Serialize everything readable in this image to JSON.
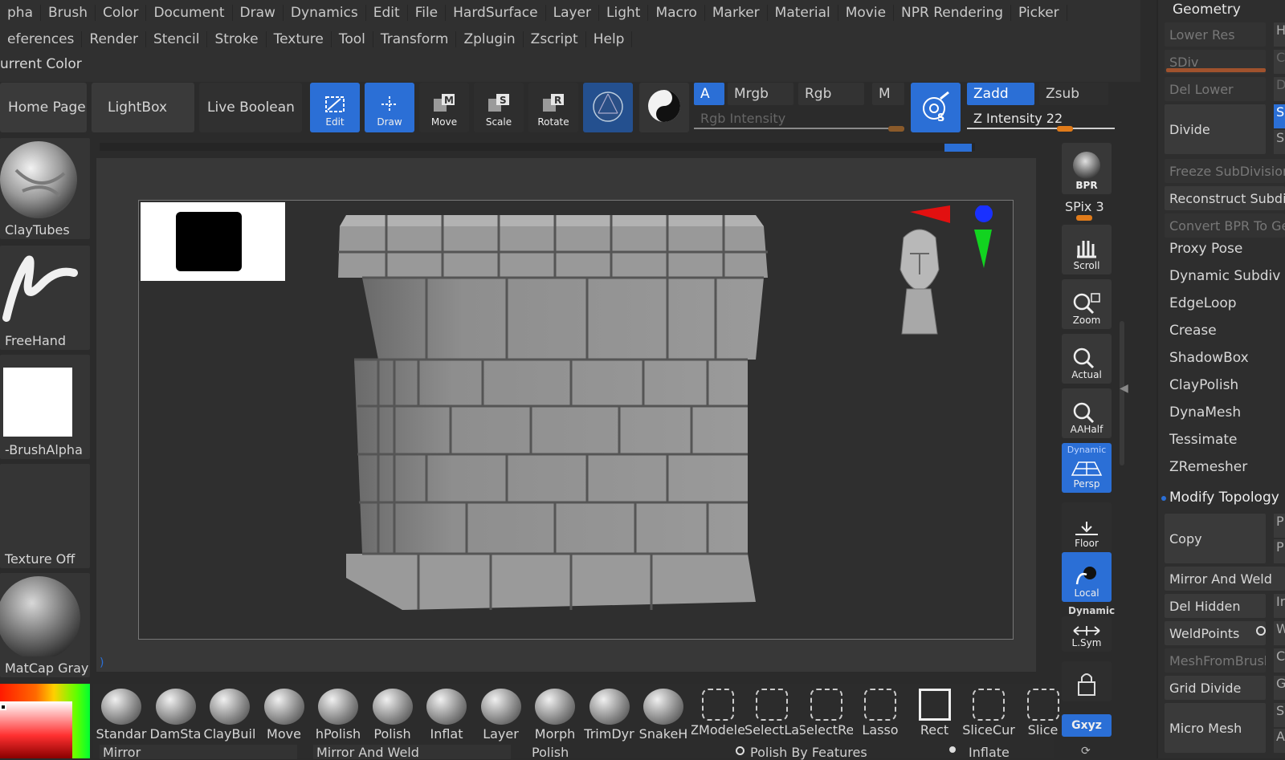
{
  "menu_row1": [
    "pha",
    "Brush",
    "Color",
    "Document",
    "Draw",
    "Dynamics",
    "Edit",
    "File",
    "HardSurface",
    "Layer",
    "Light",
    "Macro",
    "Marker",
    "Material",
    "Movie",
    "NPR Rendering",
    "Picker"
  ],
  "menu_row2": [
    "eferences",
    "Render",
    "Stencil",
    "Stroke",
    "Texture",
    "Tool",
    "Transform",
    "Zplugin",
    "Zscript",
    "Help"
  ],
  "current_color": "urrent Color",
  "shelf": {
    "home": "Home Page",
    "lightbox": "LightBox",
    "live_boolean": "Live Boolean",
    "tools": [
      "Edit",
      "Draw",
      "Move",
      "Scale",
      "Rotate"
    ]
  },
  "color_modes": {
    "a": "A",
    "mrgb": "Mrgb",
    "rgb": "Rgb",
    "m": "M",
    "rgb_intensity": "Rgb Intensity",
    "zadd": "Zadd",
    "zsub": "Zsub",
    "z_intensity": "Z Intensity 22"
  },
  "left": {
    "brush": "ClayTubes",
    "stroke": "FreeHand",
    "alpha": "-BrushAlpha",
    "texture": "Texture Off",
    "material": "MatCap Gray"
  },
  "right_shelf": {
    "bpr": "BPR",
    "spix": "SPix 3",
    "scroll": "Scroll",
    "zoom": "Zoom",
    "actual": "Actual",
    "aahalf": "AAHalf",
    "dynamic": "Dynamic",
    "persp": "Persp",
    "floor": "Floor",
    "local": "Local",
    "dynamic2": "Dynamic",
    "lsym": "L.Sym",
    "xyz": "Gxyz"
  },
  "geometry": {
    "title": "Geometry",
    "lower_res": "Lower Res",
    "sdiv": "SDiv",
    "del_lower": "Del Lower",
    "divide": "Divide",
    "freeze": "Freeze SubDivision",
    "reconstruct": "Reconstruct Subdiv",
    "convert_bpr": "Convert BPR To Geo",
    "items": [
      "Proxy Pose",
      "Dynamic Subdiv",
      "EdgeLoop",
      "Crease",
      "ShadowBox",
      "ClayPolish",
      "DynaMesh",
      "Tessimate",
      "ZRemesher"
    ],
    "modify_topology": "Modify Topology",
    "copy": "Copy",
    "mirror_weld": "Mirror And Weld",
    "del_hidden": "Del Hidden",
    "weldpoints": "WeldPoints",
    "meshfrombrush": "MeshFromBrush",
    "grid_divide": "Grid Divide",
    "micro_mesh": "Micro Mesh",
    "side": [
      "H",
      "C",
      "D",
      "S",
      "S",
      "P",
      "P",
      "Ir",
      "W",
      "C",
      "G",
      "S",
      "A"
    ]
  },
  "brushes": [
    "Standar",
    "DamSta",
    "ClayBuil",
    "Move",
    "hPolish",
    "Polish",
    "Inflat",
    "Layer",
    "Morph",
    "TrimDyr",
    "SnakeH",
    "ZModele",
    "SelectLa",
    "SelectRe",
    "Lasso",
    "Rect",
    "SliceCur",
    "Slice"
  ],
  "bottom": {
    "mirror": "Mirror",
    "mirror_weld": "Mirror And Weld",
    "polish": "Polish",
    "polish_features": "Polish By Features",
    "inflate": "Inflate"
  }
}
